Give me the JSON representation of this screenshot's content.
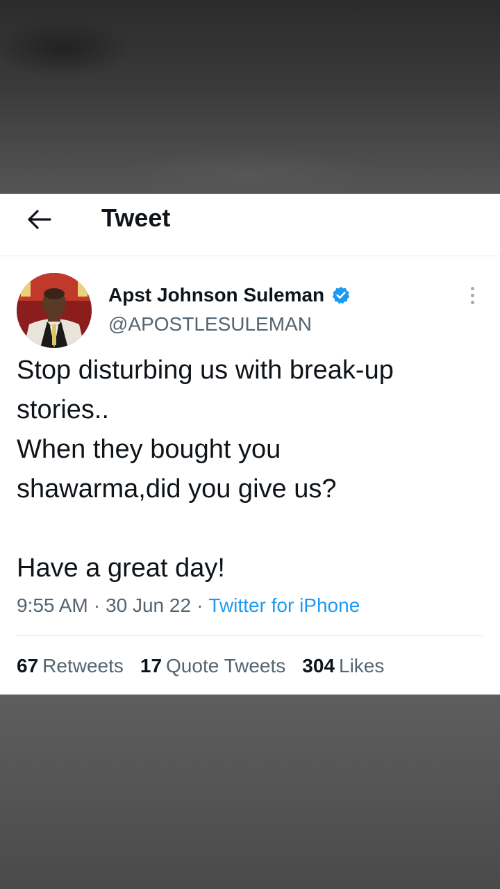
{
  "header": {
    "title": "Tweet",
    "back_icon": "arrow-left-icon"
  },
  "tweet": {
    "author_name": "Apst Johnson Suleman",
    "author_handle": "@APOSTLESULEMAN",
    "verified": true,
    "text": "Stop disturbing us with break-up\nstories..\nWhen they bought you\nshawarma,did you give us?\n\nHave a great day!",
    "time": "9:55 AM",
    "date": "30 Jun 22",
    "separator": "·",
    "source": "Twitter for iPhone"
  },
  "stats": {
    "retweets_count": "67",
    "retweets_label": "Retweets",
    "quotes_count": "17",
    "quotes_label": "Quote Tweets",
    "likes_count": "304",
    "likes_label": "Likes"
  },
  "colors": {
    "link": "#1d9bf0",
    "text": "#0f1419",
    "secondary": "#536471",
    "verified": "#1d9bf0"
  }
}
